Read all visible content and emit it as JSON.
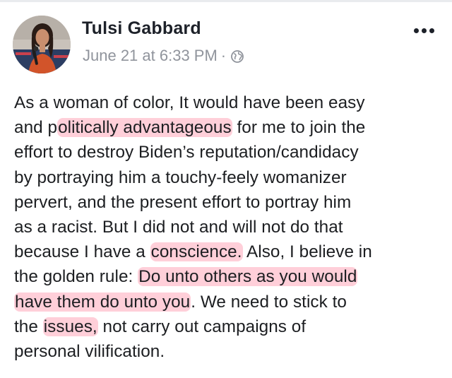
{
  "post": {
    "author_name": "Tulsi Gabbard",
    "timestamp": "June 21 at 6:33 PM",
    "separator": "·",
    "privacy_icon": "globe-icon",
    "more_icon": "more-options-icon",
    "avatar_icon": "profile-photo-avatar",
    "highlight_color": "#ff6080",
    "lines": [
      {
        "before": "As a woman of color, It would have been easy",
        "hl": "",
        "after": ""
      },
      {
        "before": "and p",
        "hl": "olitically advantageous",
        "after": " for me to join the"
      },
      {
        "before": "effort to destroy Biden’s reputation/candidacy",
        "hl": "",
        "after": ""
      },
      {
        "before": "by portraying him a touchy-feely womanizer",
        "hl": "",
        "after": ""
      },
      {
        "before": "pervert, and the present effort to portray him",
        "hl": "",
        "after": ""
      },
      {
        "before": "as a racist. But I did not and will not do that",
        "hl": "",
        "after": ""
      },
      {
        "before": "because I have a ",
        "hl": "conscience.",
        "after": " Also, I believe in"
      },
      {
        "before": "the golden rule: ",
        "hl": "Do unto others as you would",
        "after": ""
      },
      {
        "before": "",
        "hl": "have them do unto you",
        "after": ". We need to stick to"
      },
      {
        "before": "the ",
        "hl": "issues,",
        "after": " not carry out campaigns of"
      },
      {
        "before": "personal vilification.",
        "hl": "",
        "after": ""
      }
    ]
  }
}
